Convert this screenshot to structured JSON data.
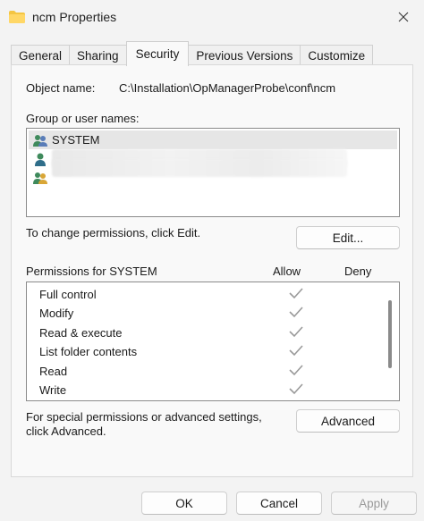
{
  "window": {
    "title": "ncm Properties",
    "icon": "folder-icon"
  },
  "tabs": [
    {
      "label": "General"
    },
    {
      "label": "Sharing"
    },
    {
      "label": "Security",
      "active": true
    },
    {
      "label": "Previous Versions"
    },
    {
      "label": "Customize"
    }
  ],
  "security": {
    "object_name_label": "Object name:",
    "object_name_value": "C:\\Installation\\OpManagerProbe\\conf\\ncm",
    "groups_label": "Group or user names:",
    "users": [
      {
        "name": "SYSTEM",
        "icon": "user-group-icon",
        "selected": true
      },
      {
        "name": "",
        "icon": "user-icon",
        "redacted": true
      },
      {
        "name": "",
        "icon": "user-group-icon",
        "redacted": true
      }
    ],
    "change_text": "To change permissions, click Edit.",
    "edit_button": "Edit...",
    "permissions_label": "Permissions for SYSTEM",
    "allow_header": "Allow",
    "deny_header": "Deny",
    "permissions": [
      {
        "name": "Full control",
        "allow": true,
        "deny": false
      },
      {
        "name": "Modify",
        "allow": true,
        "deny": false
      },
      {
        "name": "Read & execute",
        "allow": true,
        "deny": false
      },
      {
        "name": "List folder contents",
        "allow": true,
        "deny": false
      },
      {
        "name": "Read",
        "allow": true,
        "deny": false
      },
      {
        "name": "Write",
        "allow": true,
        "deny": false
      }
    ],
    "advanced_text_line1": "For special permissions or advanced settings,",
    "advanced_text_line2": "click Advanced.",
    "advanced_button": "Advanced"
  },
  "footer": {
    "ok": "OK",
    "cancel": "Cancel",
    "apply": "Apply"
  },
  "colors": {
    "check": "#9a9a9a",
    "folder": "#f4c542"
  }
}
